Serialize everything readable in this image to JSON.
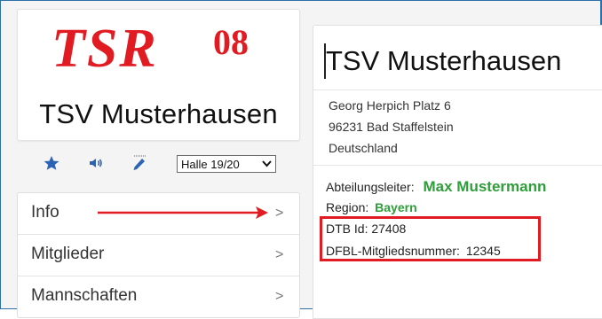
{
  "club": {
    "logo_text": "TSR 08",
    "name": "TSV Musterhausen"
  },
  "toolbar": {
    "icons": [
      "star-icon",
      "speaker-icon",
      "pencil-icon"
    ],
    "season_selected": "Halle 19/20"
  },
  "menu": {
    "items": [
      {
        "label": "Info",
        "chevron": ">"
      },
      {
        "label": "Mitglieder",
        "chevron": ">"
      },
      {
        "label": "Mannschaften",
        "chevron": ">"
      }
    ]
  },
  "details": {
    "title": "TSV Musterhausen",
    "address": {
      "street": "Georg Herpich Platz 6",
      "city": "96231 Bad Staffelstein",
      "country": "Deutschland"
    },
    "department_head_label": "Abteilungsleiter:",
    "department_head_name": "Max Mustermann",
    "region_label": "Region:",
    "region_value": "Bayern",
    "dtb_id": "DTB Id: 27408",
    "dfbl_label": "DFBL-Mitgliedsnummer:",
    "dfbl_value": "12345"
  },
  "colors": {
    "frame": "#2d6fa6",
    "logo_red": "#e11b22",
    "highlight_red": "#e11b22",
    "green": "#2e9e3a",
    "icon_blue": "#2b63b5"
  }
}
